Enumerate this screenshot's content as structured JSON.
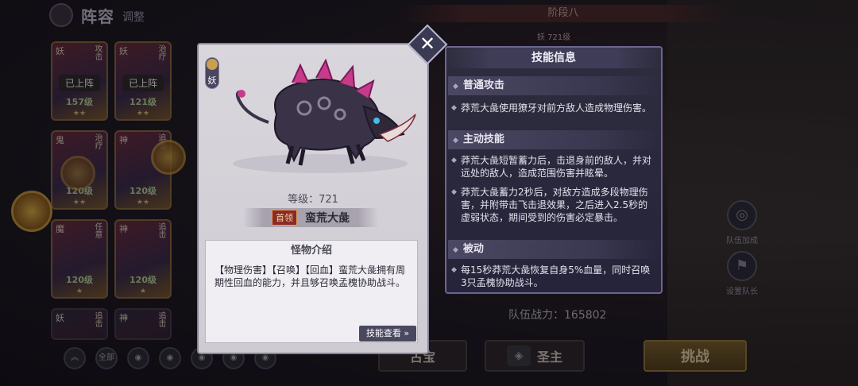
{
  "lineup": {
    "title": "阵容",
    "subtitle": "调整"
  },
  "stage": {
    "label": "阶段八",
    "race_level": "妖 721级"
  },
  "roster": [
    {
      "tag": "妖",
      "side": "攻击",
      "deployed": "已上阵",
      "level": "157级"
    },
    {
      "tag": "妖",
      "side": "治疗",
      "deployed": "已上阵",
      "level": "121级"
    },
    {
      "tag": "鬼",
      "side": "治疗",
      "deployed": "",
      "level": "120级"
    },
    {
      "tag": "神",
      "side": "追击",
      "deployed": "",
      "level": "120级"
    },
    {
      "tag": "魔",
      "side": "任意",
      "deployed": "",
      "level": "120级"
    },
    {
      "tag": "神",
      "side": "追击",
      "deployed": "",
      "level": "120级"
    },
    {
      "tag": "妖",
      "side": "追击",
      "deployed": "",
      "level": ""
    },
    {
      "tag": "神",
      "side": "追击",
      "deployed": "",
      "level": ""
    }
  ],
  "filter": {
    "all": "全部"
  },
  "monster": {
    "race": "妖",
    "level_text": "等级：721",
    "rank": "首领",
    "name": "蛮荒大彘",
    "intro_title": "怪物介绍",
    "intro_text": "【物理伤害】【召唤】【回血】蛮荒大彘拥有周期性回血的能力，并且够召唤孟槐协助战斗。",
    "skill_view": "技能查看 »"
  },
  "skills": {
    "header": "技能信息",
    "sections": [
      {
        "title": "普通攻击",
        "bullets": [
          "莽荒大彘使用獠牙对前方敌人造成物理伤害。"
        ]
      },
      {
        "title": "主动技能",
        "bullets": [
          "莽荒大彘短暂蓄力后，击退身前的敌人，并对远处的敌人，造成范围伤害并眩晕。",
          "莽荒大彘蓄力2秒后，对敌方造成多段物理伤害，并附带击飞击退效果，之后进入2.5秒的虚弱状态，期间受到的伤害必定暴击。"
        ]
      },
      {
        "title": "被动",
        "bullets": [
          "每15秒莽荒大彘恢复自身5%血量，同时召唤3只孟槐协助战斗。"
        ]
      }
    ]
  },
  "team": {
    "power_label": "队伍战力：",
    "power_value": "165802",
    "bonus": "队伍加成",
    "set_leader": "设置队长"
  },
  "buttons": {
    "treasure": "古宝",
    "lord": "圣主",
    "challenge": "挑战"
  }
}
